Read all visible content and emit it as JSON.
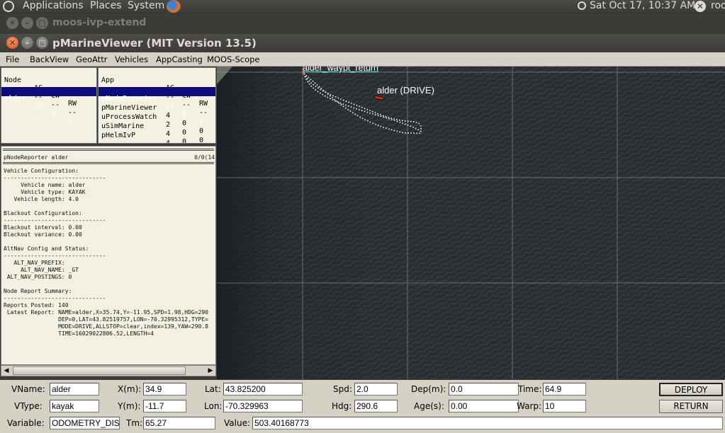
{
  "top_panel": {
    "menus": [
      "Applications",
      "Places",
      "System"
    ],
    "clock": "Sat Oct 17, 10:37 AM",
    "user": "roo"
  },
  "background_window": {
    "title": "moos-ivp-extend"
  },
  "window": {
    "title": "pMarineViewer (MIT Version 13.5)"
  },
  "menu": [
    "File",
    "BackView",
    "GeoAttr",
    "Vehicles",
    "AppCasting",
    "MOOS-Scope"
  ],
  "node_table": {
    "headers": [
      "Node",
      "AC",
      "CW",
      "RW"
    ],
    "dashes": [
      "-----",
      "--",
      "--",
      "--"
    ],
    "rows": [
      {
        "node": "alder",
        "ac": "24",
        "cw": "0",
        "rw": "0",
        "selected": true
      }
    ]
  },
  "app_table": {
    "headers": [
      "App",
      "AC",
      "CW",
      "RW"
    ],
    "dashes": [
      "-------------",
      "--",
      "--",
      "--"
    ],
    "rows": [
      {
        "app": "pNodeReporter",
        "ac": "10",
        "cw": "0",
        "rw": "0",
        "selected": true
      },
      {
        "app": "pMarineViewer",
        "ac": "4",
        "cw": "0",
        "rw": "0",
        "selected": false
      },
      {
        "app": "uProcessWatch",
        "ac": "2",
        "cw": "0",
        "rw": "0",
        "selected": false
      },
      {
        "app": "uSimMarine",
        "ac": "4",
        "cw": "0",
        "rw": "0",
        "selected": false
      },
      {
        "app": "pHelmIvP",
        "ac": "4",
        "cw": "0",
        "rw": "0",
        "selected": false
      }
    ]
  },
  "appcast": {
    "header_left": "pNodeReporter alder",
    "header_right": "0/0(14",
    "body": "Vehicle Configuration:\n------------------------------\n     Vehicle name: alder\n     Vehicle type: KAYAK\n   Vehicle length: 4.0\n\nBlackout Configuration:\n------------------------------\nBlackout interval: 0.00\nBlackout variance: 0.00\n\nAltNav Config and Status:\n------------------------------\n   ALT_NAV_PREFIX:\n     ALT_NAV_NAME: _GT\n ALT_NAV_POSTINGS: 0\n\nNode Report Summary:\n------------------------------\nReports Posted: 140\n Latest Report: NAME=alder,X=35.74,Y=-11.95,SPD=1.98,HDG=290\n                DEP=0,LAT=43.82519757,LON=-70.32995312,TYPE=\n                MODE=DRIVE,ALLSTOP=clear,index=139,YAW=290.8\n                TIME=16029022806.52,LENGTH=4"
  },
  "map": {
    "waypoint_label": "alder_waypt_return",
    "vehicle_label": "alder (DRIVE)",
    "vehicle_color": "#ff2020",
    "track_color": "#ffffff"
  },
  "fields": {
    "vname_label": "VName:",
    "vname": "alder",
    "vtype_label": "VType:",
    "vtype": "kayak",
    "variable_label": "Variable:",
    "variable": "ODOMETRY_DIST",
    "x_label": "X(m):",
    "x": "34.9",
    "y_label": "Y(m):",
    "y": "-11.7",
    "tm_label": "Tm:",
    "tm": "65.27",
    "lat_label": "Lat:",
    "lat": "43.825200",
    "lon_label": "Lon:",
    "lon": "-70.329963",
    "value_label": "Value:",
    "value": "503.40168773",
    "spd_label": "Spd:",
    "spd": "2.0",
    "hdg_label": "Hdg:",
    "hdg": "290.6",
    "dep_label": "Dep(m):",
    "dep": "0.0",
    "age_label": "Age(s):",
    "age": "0.00",
    "time_label": "Time:",
    "time": "64.9",
    "warp_label": "Warp:",
    "warp": "10"
  },
  "buttons": {
    "deploy": "DEPLOY",
    "return": "RETURN"
  }
}
